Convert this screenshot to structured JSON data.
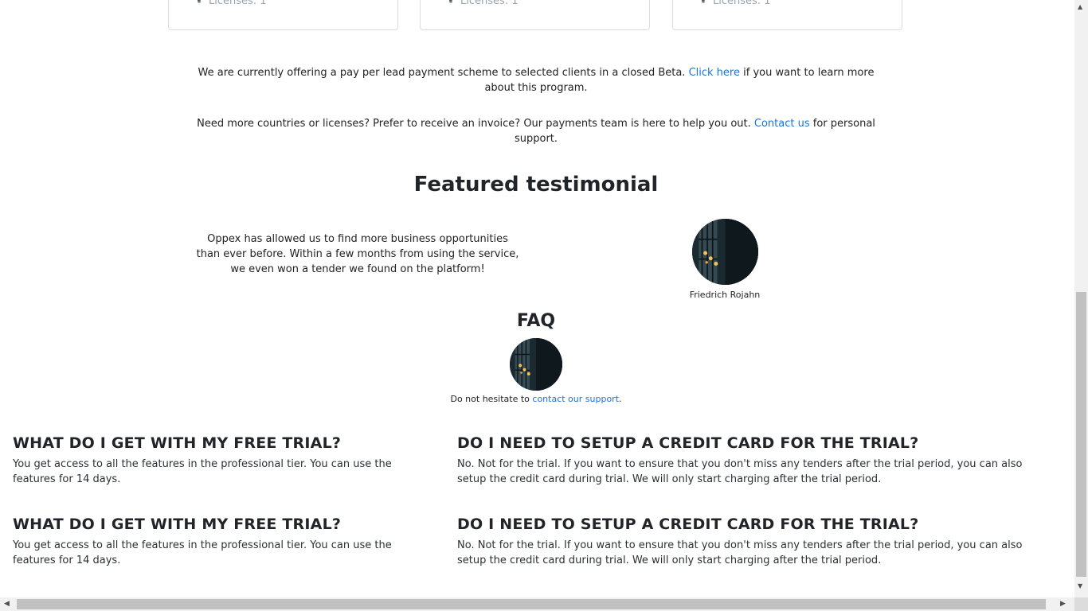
{
  "pricing_cards": [
    {
      "license_text": "Licenses: 1"
    },
    {
      "license_text": "Licenses: 1"
    },
    {
      "license_text": "Licenses: 1"
    }
  ],
  "beta_notice": {
    "text_before": "We are currently offering a pay per lead payment scheme to selected clients in a closed Beta. ",
    "link": "Click here",
    "text_after": " if you want to learn more about this program."
  },
  "support_notice": {
    "text_before": "Need more countries or licenses? Prefer to receive an invoice? Our payments team is here to help you out. ",
    "link": "Contact us",
    "text_after": " for personal support."
  },
  "testimonial": {
    "heading": "Featured testimonial",
    "quote": "Oppex has allowed us to find more business opportunities than ever before. Within a few months from using the service, we even won a tender we found on the platform!",
    "author": "Friedrich Rojahn"
  },
  "faq": {
    "heading": "FAQ",
    "help_before": "Do not hesitate to ",
    "help_link": "contact our support",
    "help_after": ".",
    "items": [
      {
        "question": "WHAT DO I GET WITH MY FREE TRIAL?",
        "answer": "You get access to all the features in the professional tier. You can use the features for 14 days."
      },
      {
        "question": "DO I NEED TO SETUP A CREDIT CARD FOR THE TRIAL?",
        "answer": "No. Not for the trial. If you want to ensure that you don't miss any tenders after the trial period, you can also setup the credit card during trial. We will only start charging after the trial period."
      },
      {
        "question": "WHAT DO I GET WITH MY FREE TRIAL?",
        "answer": "You get access to all the features in the professional tier. You can use the features for 14 days."
      },
      {
        "question": "DO I NEED TO SETUP A CREDIT CARD FOR THE TRIAL?",
        "answer": "No. Not for the trial. If you want to ensure that you don't miss any tenders after the trial period, you can also setup the credit card during trial. We will only start charging after the trial period."
      }
    ]
  },
  "colors": {
    "link": "#1a73d9",
    "text": "#212529"
  }
}
